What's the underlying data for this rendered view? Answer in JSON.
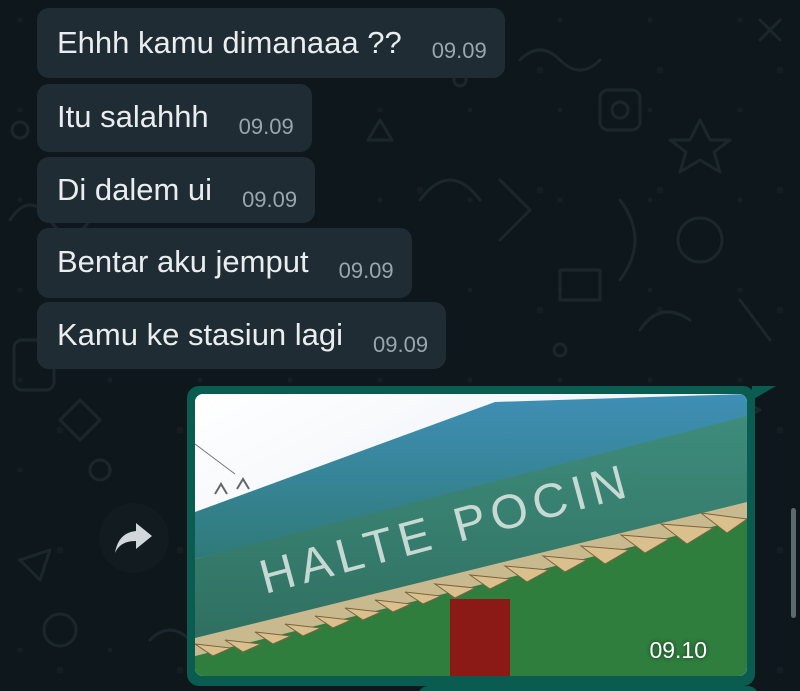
{
  "messages_incoming": [
    {
      "text": "Ehhh kamu dimanaaa ??",
      "time": "09.09"
    },
    {
      "text": "Itu salahhh",
      "time": "09.09"
    },
    {
      "text": "Di dalem ui",
      "time": "09.09"
    },
    {
      "text": "Bentar aku jemput",
      "time": "09.09"
    },
    {
      "text": "Kamu ke stasiun lagi",
      "time": "09.09"
    }
  ],
  "message_outgoing": {
    "type": "image",
    "photo_sign_text": "HALTE POCIN",
    "time": "09.10",
    "status_icon": "double-check-icon"
  },
  "forward_button": {
    "icon": "forward-arrow-icon"
  },
  "colors": {
    "chat_background": "#0e171c",
    "incoming_bubble": "#202c33",
    "outgoing_bubble": "#0a5c50",
    "text_primary": "#e9edef",
    "text_time": "#9aa6ad"
  }
}
